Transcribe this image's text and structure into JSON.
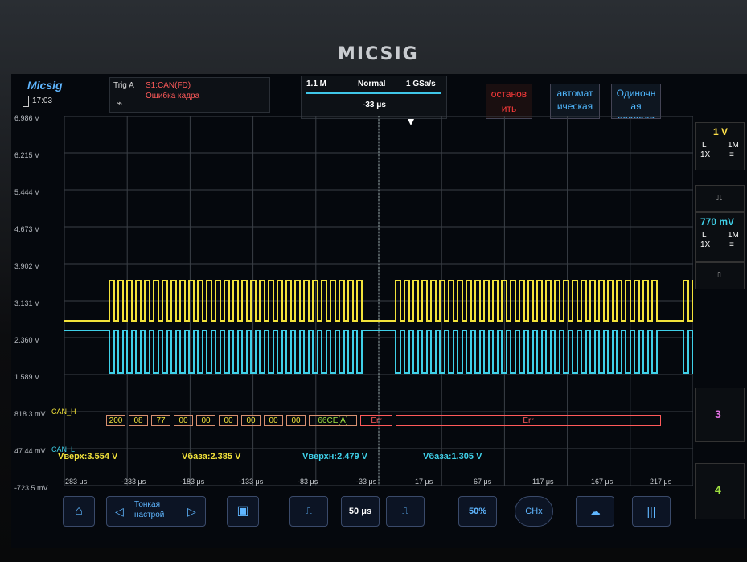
{
  "device": {
    "brand": "MICSIG"
  },
  "topbar": {
    "logo": "Micsig",
    "time": "17:03",
    "trig_label": "Trig  A",
    "trig_source": "S1:CAN(FD)",
    "trig_condition": "Ошибка кадра",
    "memory_depth": "1.1 M",
    "acq_mode": "Normal",
    "sample_rate": "1 GSa/s",
    "trig_position": "-33 μs",
    "btn_stop": [
      "остановить"
    ],
    "btn_stop_l1": "останов",
    "btn_stop_l2": "ить",
    "btn_auto_l1": "автомат",
    "btn_auto_l2": "ическая",
    "btn_single_l1": "Одиночн",
    "btn_single_l2": "ая",
    "btn_single_l3": "последо"
  },
  "y_axis_labels": [
    "6.986 V",
    "6.215 V",
    "5.444 V",
    "4.673 V",
    "3.902 V",
    "3.131 V",
    "2.360 V",
    "1.589 V",
    "818.3 mV",
    "47.44 mV",
    "-723.5 mV"
  ],
  "x_axis_labels": [
    "-283 μs",
    "-233 μs",
    "-183 μs",
    "-133 μs",
    "-83 μs",
    "-33 μs",
    "17 μs",
    "67 μs",
    "117 μs",
    "167 μs",
    "217 μs"
  ],
  "channels": {
    "ch1": {
      "scale": "1 V",
      "coupling": "L",
      "probe": "1X",
      "impedance": "1M",
      "color": "#f2e23a"
    },
    "ch2": {
      "scale": "770 mV",
      "coupling": "L",
      "probe": "1X",
      "impedance": "1M",
      "color": "#3fd0e8"
    },
    "ch3": {
      "label": "3",
      "color": "#e070e0"
    },
    "ch4": {
      "label": "4",
      "color": "#9fe040"
    }
  },
  "decode": {
    "bus_label": "CAN_H",
    "bus_label2": "CAN_L",
    "frames": [
      "200",
      "08",
      "77",
      "00",
      "00",
      "00",
      "00",
      "00",
      "00",
      "66CE[A]",
      "Err",
      "Err"
    ]
  },
  "measurements": {
    "ch1_top": "Vверх:3.554 V",
    "ch1_base": "Vбаза:2.385 V",
    "ch2_top": "Vверхн:2.479 V",
    "ch2_base": "Vбаза:1.305 V"
  },
  "toolbar": {
    "fine_label": "Тонкая",
    "fine_label2": "настрой",
    "timebase": "50 μs",
    "percent": "50%",
    "chx": "CHx"
  },
  "colors": {
    "yellow": "#f2e23a",
    "cyan": "#3fd0e8",
    "accent": "#4fb8ff",
    "error": "#ff5a5a"
  }
}
